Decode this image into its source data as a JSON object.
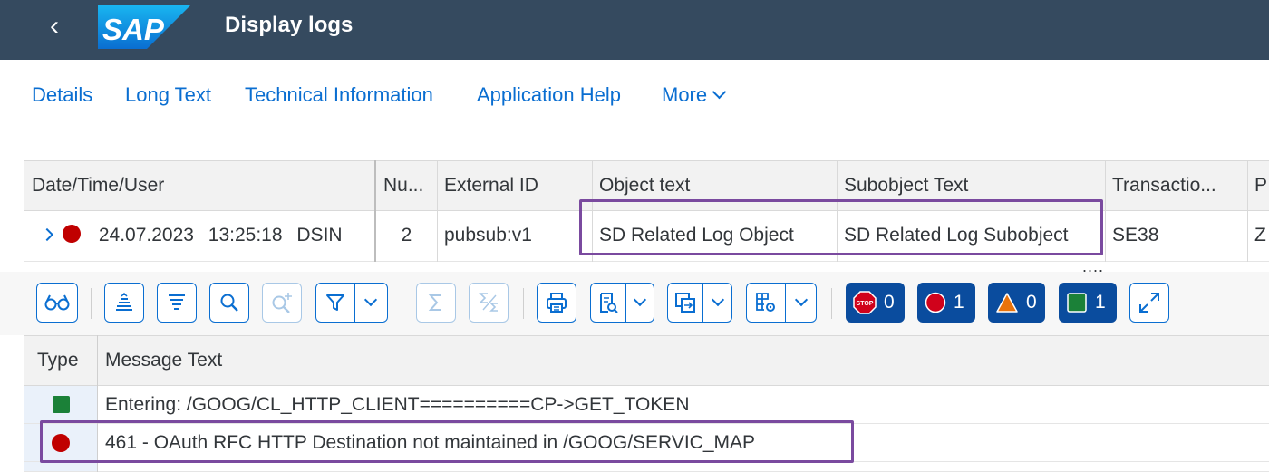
{
  "shell": {
    "title": "Display logs",
    "logo_text": "SAP",
    "back_glyph": "‹"
  },
  "actions": [
    "Details",
    "Long Text",
    "Technical Information",
    "Application Help",
    "More"
  ],
  "header_table": {
    "columns": [
      "Date/Time/User",
      "Nu...",
      "External ID",
      "Object text",
      "Subobject Text",
      "Transactio...",
      "P"
    ],
    "row": {
      "date": "24.07.2023",
      "time": "13:25:18",
      "user": "DSIN",
      "number": "2",
      "external_id": "pubsub:v1",
      "object_text": "SD Related Log Object",
      "subobject_text": "SD Related Log Subobject",
      "transaction": "SE38",
      "program": "Z",
      "status_color": "#c00000"
    },
    "more_indicator": "...."
  },
  "toolbar": {
    "icons": [
      "glasses-icon",
      "sort-ascending-icon",
      "sort-descending-icon",
      "search-icon",
      "search-next-icon",
      "filter-icon",
      "sum-icon",
      "subtotal-icon",
      "print-icon",
      "view-icon",
      "export-icon",
      "layout-icon",
      "fullscreen-icon"
    ],
    "counters": {
      "stop": "0",
      "error": "1",
      "warning": "0",
      "success": "1"
    }
  },
  "message_table": {
    "columns": [
      "Type",
      "Message Text"
    ],
    "rows": [
      {
        "type": "success",
        "text": "Entering: /GOOG/CL_HTTP_CLIENT==========CP->GET_TOKEN"
      },
      {
        "type": "error",
        "text": "461 - OAuth RFC HTTP Destination not maintained in /GOOG/SERVIC_MAP"
      }
    ]
  },
  "colors": {
    "shell": "#354a5f",
    "accent": "#0a6ed1",
    "error": "#c00000",
    "success": "#1b8138",
    "warning": "#e9730c",
    "counter_bg": "#0a4c9e",
    "highlight": "#7a4a9f"
  }
}
